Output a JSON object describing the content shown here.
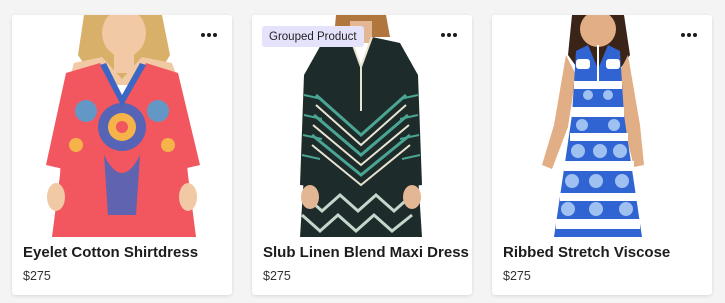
{
  "products": [
    {
      "name": "Eyelet Cotton Shirtdress",
      "price": "$275",
      "badge": "",
      "accent": "#f2565f",
      "pattern": "#3b66c4"
    },
    {
      "name": "Slub Linen Blend Maxi Dress",
      "price": "$275",
      "badge": "Grouped Product",
      "accent": "#1d2b2a",
      "pattern": "#4aa593"
    },
    {
      "name": "Ribbed Stretch Viscose",
      "price": "$275",
      "badge": "",
      "accent": "#2f64d2",
      "pattern": "#ffffff"
    }
  ],
  "icons": {
    "more": "more-horizontal-icon"
  },
  "colors": {
    "badge_bg": "#e5e2fb",
    "page_bg": "#f4f4f4"
  }
}
